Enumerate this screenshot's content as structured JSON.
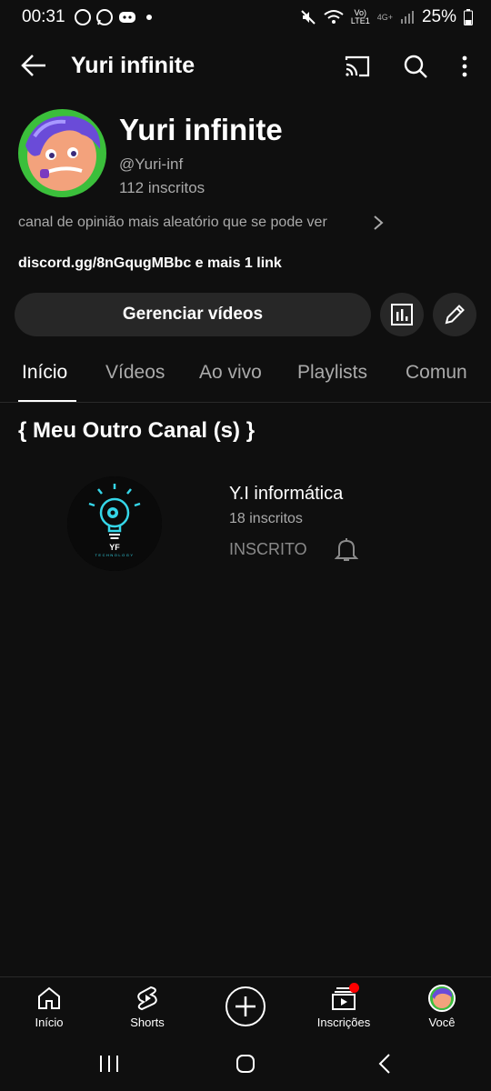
{
  "status_bar": {
    "time": "00:31",
    "battery": "25%",
    "network_label_top": "Vo)",
    "network_label_bottom": "LTE1",
    "network_gen": "4G+"
  },
  "app_bar": {
    "title": "Yuri infinite",
    "icons": [
      "back-arrow-icon",
      "cast-icon",
      "search-icon",
      "more-vert-icon"
    ]
  },
  "channel": {
    "name": "Yuri infinite",
    "handle": "@Yuri-inf",
    "subscribers": "112 inscritos",
    "description": "canal de opinião mais aleatório que se pode ver",
    "link": "discord.gg/8nGqugMBbc e mais 1 link",
    "manage_button": "Gerenciar vídeos"
  },
  "tabs": [
    {
      "label": "Início",
      "active": true
    },
    {
      "label": "Vídeos",
      "active": false
    },
    {
      "label": "Ao vivo",
      "active": false
    },
    {
      "label": "Playlists",
      "active": false
    },
    {
      "label": "Comun",
      "active": false
    }
  ],
  "section": {
    "title": "{ Meu Outro Canal (s) }"
  },
  "featured_channel": {
    "name": "Y.I informática",
    "subscribers": "18 inscritos",
    "subscribe_status": "INSCRITO",
    "logo_text": "YF",
    "logo_subtext": "TECHNOLOGY"
  },
  "bottom_nav": [
    {
      "label": "Início",
      "icon": "home-icon"
    },
    {
      "label": "Shorts",
      "icon": "shorts-icon"
    },
    {
      "label": "",
      "icon": "create-icon"
    },
    {
      "label": "Inscrições",
      "icon": "subscriptions-icon"
    },
    {
      "label": "Você",
      "icon": "you-avatar-icon"
    }
  ],
  "colors": {
    "background": "#0f0f0f",
    "button_bg": "#272727",
    "secondary_text": "#aaaaaa",
    "accent_red": "#ff0000",
    "logo_cyan": "#35d6e8"
  }
}
